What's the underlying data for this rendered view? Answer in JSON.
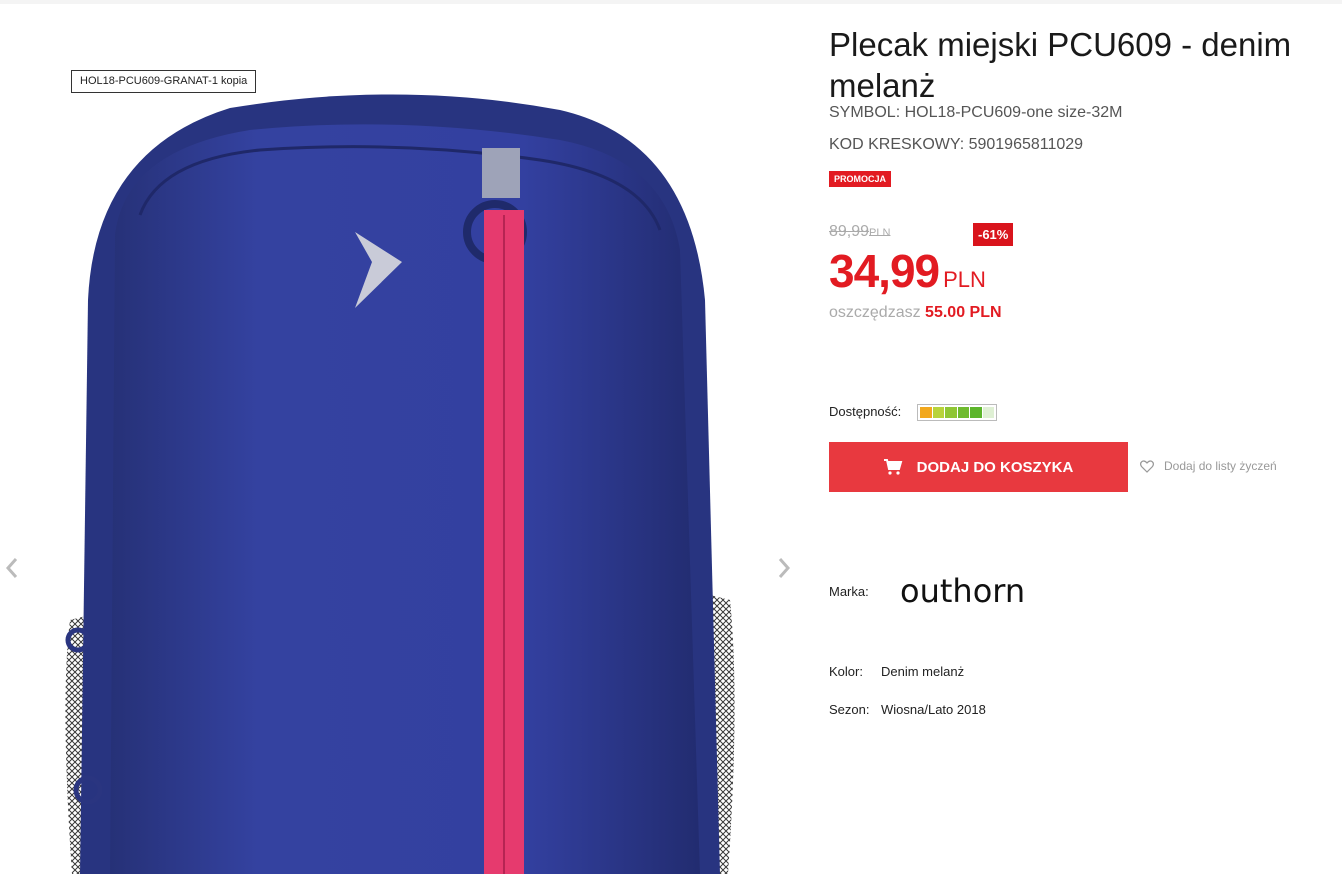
{
  "gallery": {
    "image_caption": "HOL18-PCU609-GRANAT-1 kopia",
    "prev_icon": "chevron-left-icon",
    "next_icon": "chevron-right-icon"
  },
  "product": {
    "title": "Plecak miejski PCU609 - denim melanż",
    "symbol": "SYMBOL: HOL18-PCU609-one size-32M",
    "barcode": "KOD KRESKOWY: 5901965811029",
    "promo_badge": "PROMOCJA",
    "old_price": "89,99",
    "old_price_currency": "PLN",
    "discount": "-61%",
    "price": "34,99",
    "price_currency": "PLN",
    "savings_label": "oszczędzasz",
    "savings_value": "55.00 PLN",
    "availability_label": "Dostępność:",
    "availability_level": 0.83,
    "add_to_cart_label": "DODAJ DO KOSZYKA",
    "add_to_cart_icon": "cart-icon",
    "wishlist_label": "Dodaj do listy życzeń",
    "wishlist_icon": "heart-icon",
    "brand_label": "Marka:",
    "brand_logo": "outhorn",
    "color_label": "Kolor:",
    "color_value": "Denim melanż",
    "season_label": "Sezon:",
    "season_value": "Wiosna/Lato 2018"
  },
  "colors": {
    "accent_red": "#e21b22",
    "button_red": "#e8393f",
    "backpack_navy": "#2e3a8c",
    "zipper_pink": "#e63a6e"
  }
}
